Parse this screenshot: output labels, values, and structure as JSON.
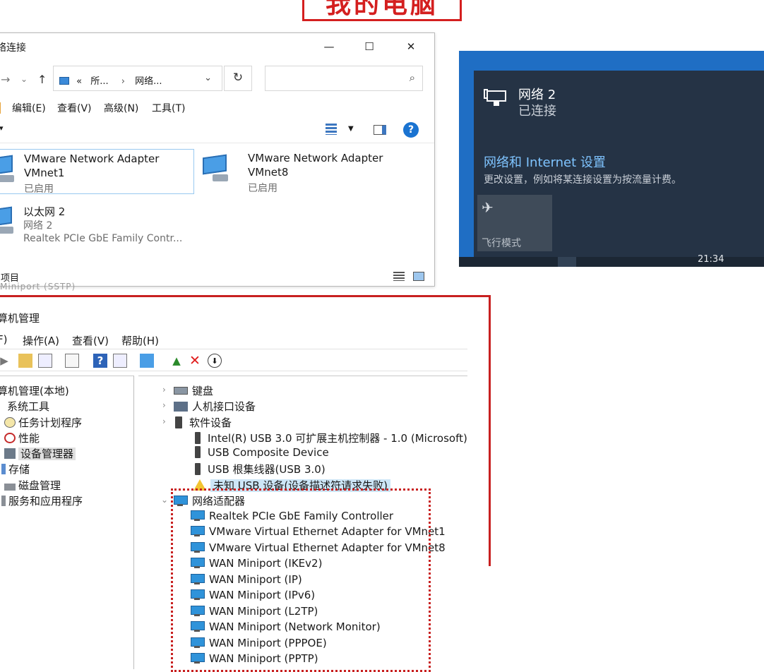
{
  "banner": {
    "text": "我的电脑"
  },
  "explorer": {
    "title": "络连接",
    "window_buttons": [
      "—",
      "☐",
      "✕"
    ],
    "address_parts": [
      "«",
      "所...",
      "›",
      "网络..."
    ],
    "menu": [
      "编辑(E)",
      "查看(V)",
      "高级(N)",
      "工具(T)"
    ],
    "items": [
      {
        "name": "VMware Network Adapter",
        "sub": "VMnet1",
        "state": "已启用"
      },
      {
        "name": "VMware Network Adapter",
        "sub": "VMnet8",
        "state": "已启用"
      },
      {
        "name": "以太网 2",
        "sub": "网络 2",
        "state": "Realtek PCIe GbE Family Contr..."
      }
    ],
    "status": "项目"
  },
  "flyout": {
    "network_name": "网络 2",
    "network_state": "已连接",
    "settings_link": "网络和 Internet 设置",
    "settings_desc": "更改设置，例如将某连接设置为按流量计费。",
    "airplane_label": "飞行模式",
    "clock": "21:34"
  },
  "ghost_text": "Miniport (SSTP)",
  "computer_management": {
    "title": "算机管理",
    "menu": [
      "F)",
      "操作(A)",
      "查看(V)",
      "帮助(H)"
    ],
    "tree": [
      "算机管理(本地)",
      "系统工具",
      "任务计划程序",
      "性能",
      "设备管理器",
      "存储",
      "磁盘管理",
      "服务和应用程序"
    ],
    "devices": {
      "categories": [
        "键盘",
        "人机接口设备",
        "软件设备"
      ],
      "usb": [
        "Intel(R) USB 3.0 可扩展主机控制器 - 1.0 (Microsoft)",
        "USB Composite Device",
        "USB 根集线器(USB 3.0)"
      ],
      "usb_warning": "未知 USB 设备(设备描述符请求失败)",
      "network_category": "网络适配器",
      "network": [
        "Realtek PCIe GbE Family Controller",
        "VMware Virtual Ethernet Adapter for VMnet1",
        "VMware Virtual Ethernet Adapter for VMnet8",
        "WAN Miniport (IKEv2)",
        "WAN Miniport (IP)",
        "WAN Miniport (IPv6)",
        "WAN Miniport (L2TP)",
        "WAN Miniport (Network Monitor)",
        "WAN Miniport (PPPOE)",
        "WAN Miniport (PPTP)"
      ]
    }
  },
  "colors": {
    "annotation_red": "#c82020",
    "flyout_panel": "#253345",
    "flyout_link": "#7fc4ff",
    "desktop_blue": "#1f6ec4"
  }
}
